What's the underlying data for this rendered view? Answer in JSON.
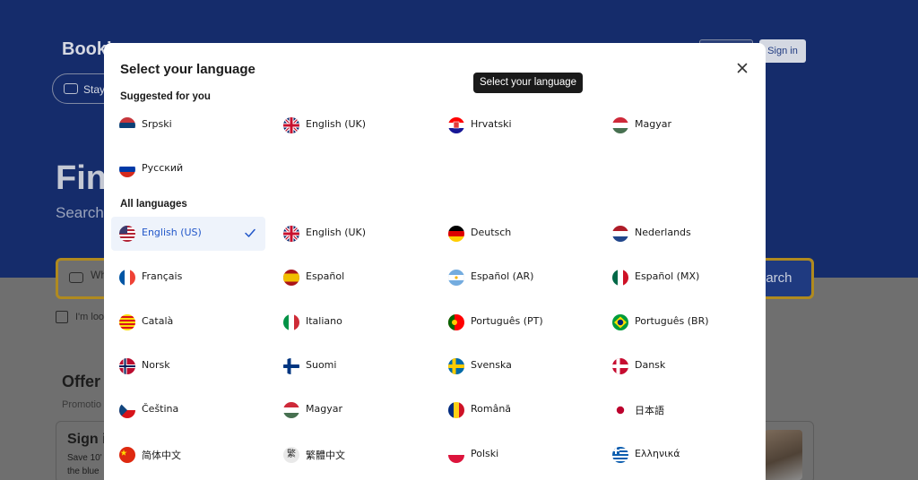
{
  "background": {
    "logo_partial": "Booki",
    "stays_pill": "Stay",
    "signin_label": "Sign in",
    "hero_partial": "Fin",
    "hero_sub_partial": "Search",
    "search_partial": "Wh",
    "search_button_partial": "earch",
    "checkbox_label_partial": "I'm loo",
    "offers_partial": "Offer",
    "offers_sub_partial": "Promotio",
    "card_title_partial": "Sign i",
    "card_line1_partial": "Save 10'",
    "card_line2_partial": "the blue"
  },
  "modal": {
    "title": "Select your language",
    "tooltip": "Select your language",
    "suggested_title": "Suggested for you",
    "all_title": "All languages",
    "suggested": [
      {
        "label": "Srpski",
        "flag": "rs"
      },
      {
        "label": "English (UK)",
        "flag": "gb"
      },
      {
        "label": "Hrvatski",
        "flag": "hr"
      },
      {
        "label": "Magyar",
        "flag": "hu"
      },
      {
        "label": "Русский",
        "flag": "ru"
      }
    ],
    "all": [
      {
        "label": "English (US)",
        "flag": "us",
        "selected": true
      },
      {
        "label": "English (UK)",
        "flag": "gb"
      },
      {
        "label": "Deutsch",
        "flag": "de"
      },
      {
        "label": "Nederlands",
        "flag": "nl"
      },
      {
        "label": "Français",
        "flag": "fr"
      },
      {
        "label": "Español",
        "flag": "es"
      },
      {
        "label": "Español (AR)",
        "flag": "ar"
      },
      {
        "label": "Español (MX)",
        "flag": "mx"
      },
      {
        "label": "Català",
        "flag": "ca"
      },
      {
        "label": "Italiano",
        "flag": "it"
      },
      {
        "label": "Português (PT)",
        "flag": "pt"
      },
      {
        "label": "Português (BR)",
        "flag": "br"
      },
      {
        "label": "Norsk",
        "flag": "no"
      },
      {
        "label": "Suomi",
        "flag": "fi"
      },
      {
        "label": "Svenska",
        "flag": "se"
      },
      {
        "label": "Dansk",
        "flag": "dk"
      },
      {
        "label": "Čeština",
        "flag": "cz"
      },
      {
        "label": "Magyar",
        "flag": "hu"
      },
      {
        "label": "Română",
        "flag": "ro"
      },
      {
        "label": "日本語",
        "flag": "jp"
      },
      {
        "label": "简体中文",
        "flag": "cn"
      },
      {
        "label": "繁體中文",
        "flag": "tw",
        "glyph": "繁"
      },
      {
        "label": "Polski",
        "flag": "pl"
      },
      {
        "label": "Ελληνικά",
        "flag": "gr"
      }
    ]
  },
  "colors": {
    "header_blue": "#152c6b",
    "selected_bg": "#eef3fb",
    "selected_text": "#2156c9",
    "tooltip_bg": "#1a1a1a"
  }
}
